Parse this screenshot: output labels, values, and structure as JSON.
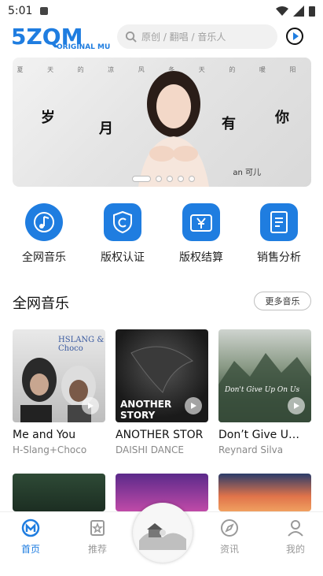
{
  "status_bar": {
    "time": "5:01"
  },
  "header": {
    "logo_text": "5ZQM",
    "logo_sub": "ORIGINAL MUSIC",
    "search_placeholder": "原创 / 翻唱 / 音乐人"
  },
  "banner": {
    "topline": "夏 天 的 凉 风 冬 天 的 暖 阳",
    "chars": [
      "岁",
      "月",
      "有",
      "你"
    ],
    "artist": "an 可儿",
    "active_index": 0,
    "dot_count": 5
  },
  "quick_links": [
    {
      "label": "全网音乐",
      "icon": "music-network-icon"
    },
    {
      "label": "版权认证",
      "icon": "copyright-shield-icon"
    },
    {
      "label": "版权结算",
      "icon": "yen-wallet-icon"
    },
    {
      "label": "销售分析",
      "icon": "sales-report-icon"
    }
  ],
  "section": {
    "title": "全网音乐",
    "more": "更多音乐"
  },
  "cards": [
    {
      "title": "Me and You",
      "artist": "H-Slang+Choco",
      "cover_text": "HSLANG & Choco"
    },
    {
      "title": "ANOTHER STOR",
      "artist": "DAISHI DANCE",
      "cover_text": "ANOTHER STORY"
    },
    {
      "title": "Don’t Give U…",
      "artist": "Reynard Silva",
      "cover_text": "Don't Give Up On Us"
    }
  ],
  "tabbar": {
    "items": [
      {
        "label": "首页",
        "icon": "home-icon",
        "active": true
      },
      {
        "label": "推荐",
        "icon": "recommend-icon",
        "active": false
      },
      {
        "label": "资讯",
        "icon": "compass-icon",
        "active": false
      },
      {
        "label": "我的",
        "icon": "user-icon",
        "active": false
      }
    ]
  },
  "colors": {
    "accent": "#1f7de0",
    "tab_inactive": "#999999"
  }
}
